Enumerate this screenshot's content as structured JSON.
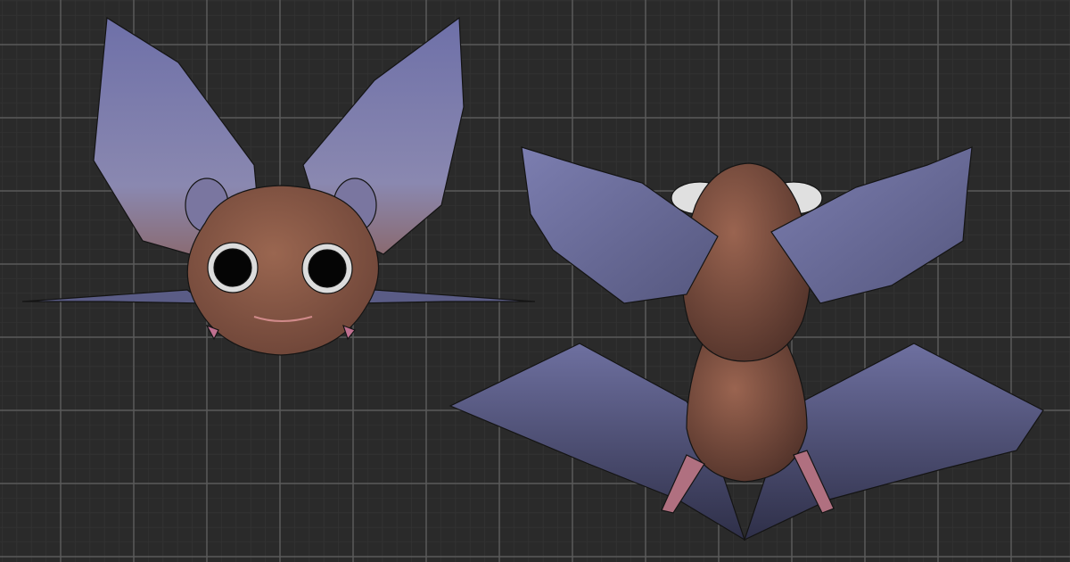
{
  "colors": {
    "background": "#2a2a2a",
    "grid_minor": "#323232",
    "grid_major": "#5a5a5a",
    "skin": "#8a5a48",
    "skin_dark": "#5a3a30",
    "membrane": "#6a6c9a",
    "membrane_dark": "#34344f",
    "eye": "#050505",
    "eye_ring": "#dcdcdc",
    "wire": "#141414"
  }
}
